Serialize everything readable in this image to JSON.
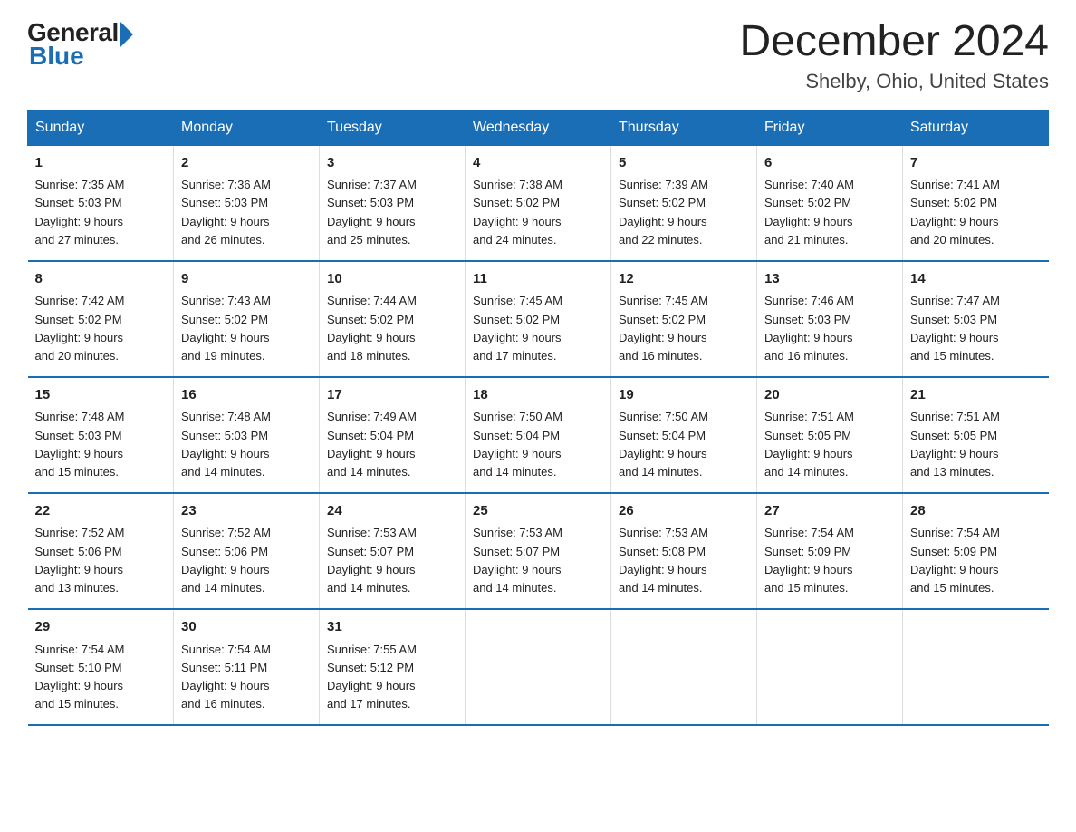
{
  "logo": {
    "general": "General",
    "blue": "Blue"
  },
  "header": {
    "month_year": "December 2024",
    "location": "Shelby, Ohio, United States"
  },
  "days_of_week": [
    "Sunday",
    "Monday",
    "Tuesday",
    "Wednesday",
    "Thursday",
    "Friday",
    "Saturday"
  ],
  "weeks": [
    [
      {
        "day": "1",
        "sunrise": "7:35 AM",
        "sunset": "5:03 PM",
        "daylight": "9 hours and 27 minutes."
      },
      {
        "day": "2",
        "sunrise": "7:36 AM",
        "sunset": "5:03 PM",
        "daylight": "9 hours and 26 minutes."
      },
      {
        "day": "3",
        "sunrise": "7:37 AM",
        "sunset": "5:03 PM",
        "daylight": "9 hours and 25 minutes."
      },
      {
        "day": "4",
        "sunrise": "7:38 AM",
        "sunset": "5:02 PM",
        "daylight": "9 hours and 24 minutes."
      },
      {
        "day": "5",
        "sunrise": "7:39 AM",
        "sunset": "5:02 PM",
        "daylight": "9 hours and 22 minutes."
      },
      {
        "day": "6",
        "sunrise": "7:40 AM",
        "sunset": "5:02 PM",
        "daylight": "9 hours and 21 minutes."
      },
      {
        "day": "7",
        "sunrise": "7:41 AM",
        "sunset": "5:02 PM",
        "daylight": "9 hours and 20 minutes."
      }
    ],
    [
      {
        "day": "8",
        "sunrise": "7:42 AM",
        "sunset": "5:02 PM",
        "daylight": "9 hours and 20 minutes."
      },
      {
        "day": "9",
        "sunrise": "7:43 AM",
        "sunset": "5:02 PM",
        "daylight": "9 hours and 19 minutes."
      },
      {
        "day": "10",
        "sunrise": "7:44 AM",
        "sunset": "5:02 PM",
        "daylight": "9 hours and 18 minutes."
      },
      {
        "day": "11",
        "sunrise": "7:45 AM",
        "sunset": "5:02 PM",
        "daylight": "9 hours and 17 minutes."
      },
      {
        "day": "12",
        "sunrise": "7:45 AM",
        "sunset": "5:02 PM",
        "daylight": "9 hours and 16 minutes."
      },
      {
        "day": "13",
        "sunrise": "7:46 AM",
        "sunset": "5:03 PM",
        "daylight": "9 hours and 16 minutes."
      },
      {
        "day": "14",
        "sunrise": "7:47 AM",
        "sunset": "5:03 PM",
        "daylight": "9 hours and 15 minutes."
      }
    ],
    [
      {
        "day": "15",
        "sunrise": "7:48 AM",
        "sunset": "5:03 PM",
        "daylight": "9 hours and 15 minutes."
      },
      {
        "day": "16",
        "sunrise": "7:48 AM",
        "sunset": "5:03 PM",
        "daylight": "9 hours and 14 minutes."
      },
      {
        "day": "17",
        "sunrise": "7:49 AM",
        "sunset": "5:04 PM",
        "daylight": "9 hours and 14 minutes."
      },
      {
        "day": "18",
        "sunrise": "7:50 AM",
        "sunset": "5:04 PM",
        "daylight": "9 hours and 14 minutes."
      },
      {
        "day": "19",
        "sunrise": "7:50 AM",
        "sunset": "5:04 PM",
        "daylight": "9 hours and 14 minutes."
      },
      {
        "day": "20",
        "sunrise": "7:51 AM",
        "sunset": "5:05 PM",
        "daylight": "9 hours and 14 minutes."
      },
      {
        "day": "21",
        "sunrise": "7:51 AM",
        "sunset": "5:05 PM",
        "daylight": "9 hours and 13 minutes."
      }
    ],
    [
      {
        "day": "22",
        "sunrise": "7:52 AM",
        "sunset": "5:06 PM",
        "daylight": "9 hours and 13 minutes."
      },
      {
        "day": "23",
        "sunrise": "7:52 AM",
        "sunset": "5:06 PM",
        "daylight": "9 hours and 14 minutes."
      },
      {
        "day": "24",
        "sunrise": "7:53 AM",
        "sunset": "5:07 PM",
        "daylight": "9 hours and 14 minutes."
      },
      {
        "day": "25",
        "sunrise": "7:53 AM",
        "sunset": "5:07 PM",
        "daylight": "9 hours and 14 minutes."
      },
      {
        "day": "26",
        "sunrise": "7:53 AM",
        "sunset": "5:08 PM",
        "daylight": "9 hours and 14 minutes."
      },
      {
        "day": "27",
        "sunrise": "7:54 AM",
        "sunset": "5:09 PM",
        "daylight": "9 hours and 15 minutes."
      },
      {
        "day": "28",
        "sunrise": "7:54 AM",
        "sunset": "5:09 PM",
        "daylight": "9 hours and 15 minutes."
      }
    ],
    [
      {
        "day": "29",
        "sunrise": "7:54 AM",
        "sunset": "5:10 PM",
        "daylight": "9 hours and 15 minutes."
      },
      {
        "day": "30",
        "sunrise": "7:54 AM",
        "sunset": "5:11 PM",
        "daylight": "9 hours and 16 minutes."
      },
      {
        "day": "31",
        "sunrise": "7:55 AM",
        "sunset": "5:12 PM",
        "daylight": "9 hours and 17 minutes."
      },
      null,
      null,
      null,
      null
    ]
  ],
  "labels": {
    "sunrise": "Sunrise:",
    "sunset": "Sunset:",
    "daylight": "Daylight:"
  }
}
